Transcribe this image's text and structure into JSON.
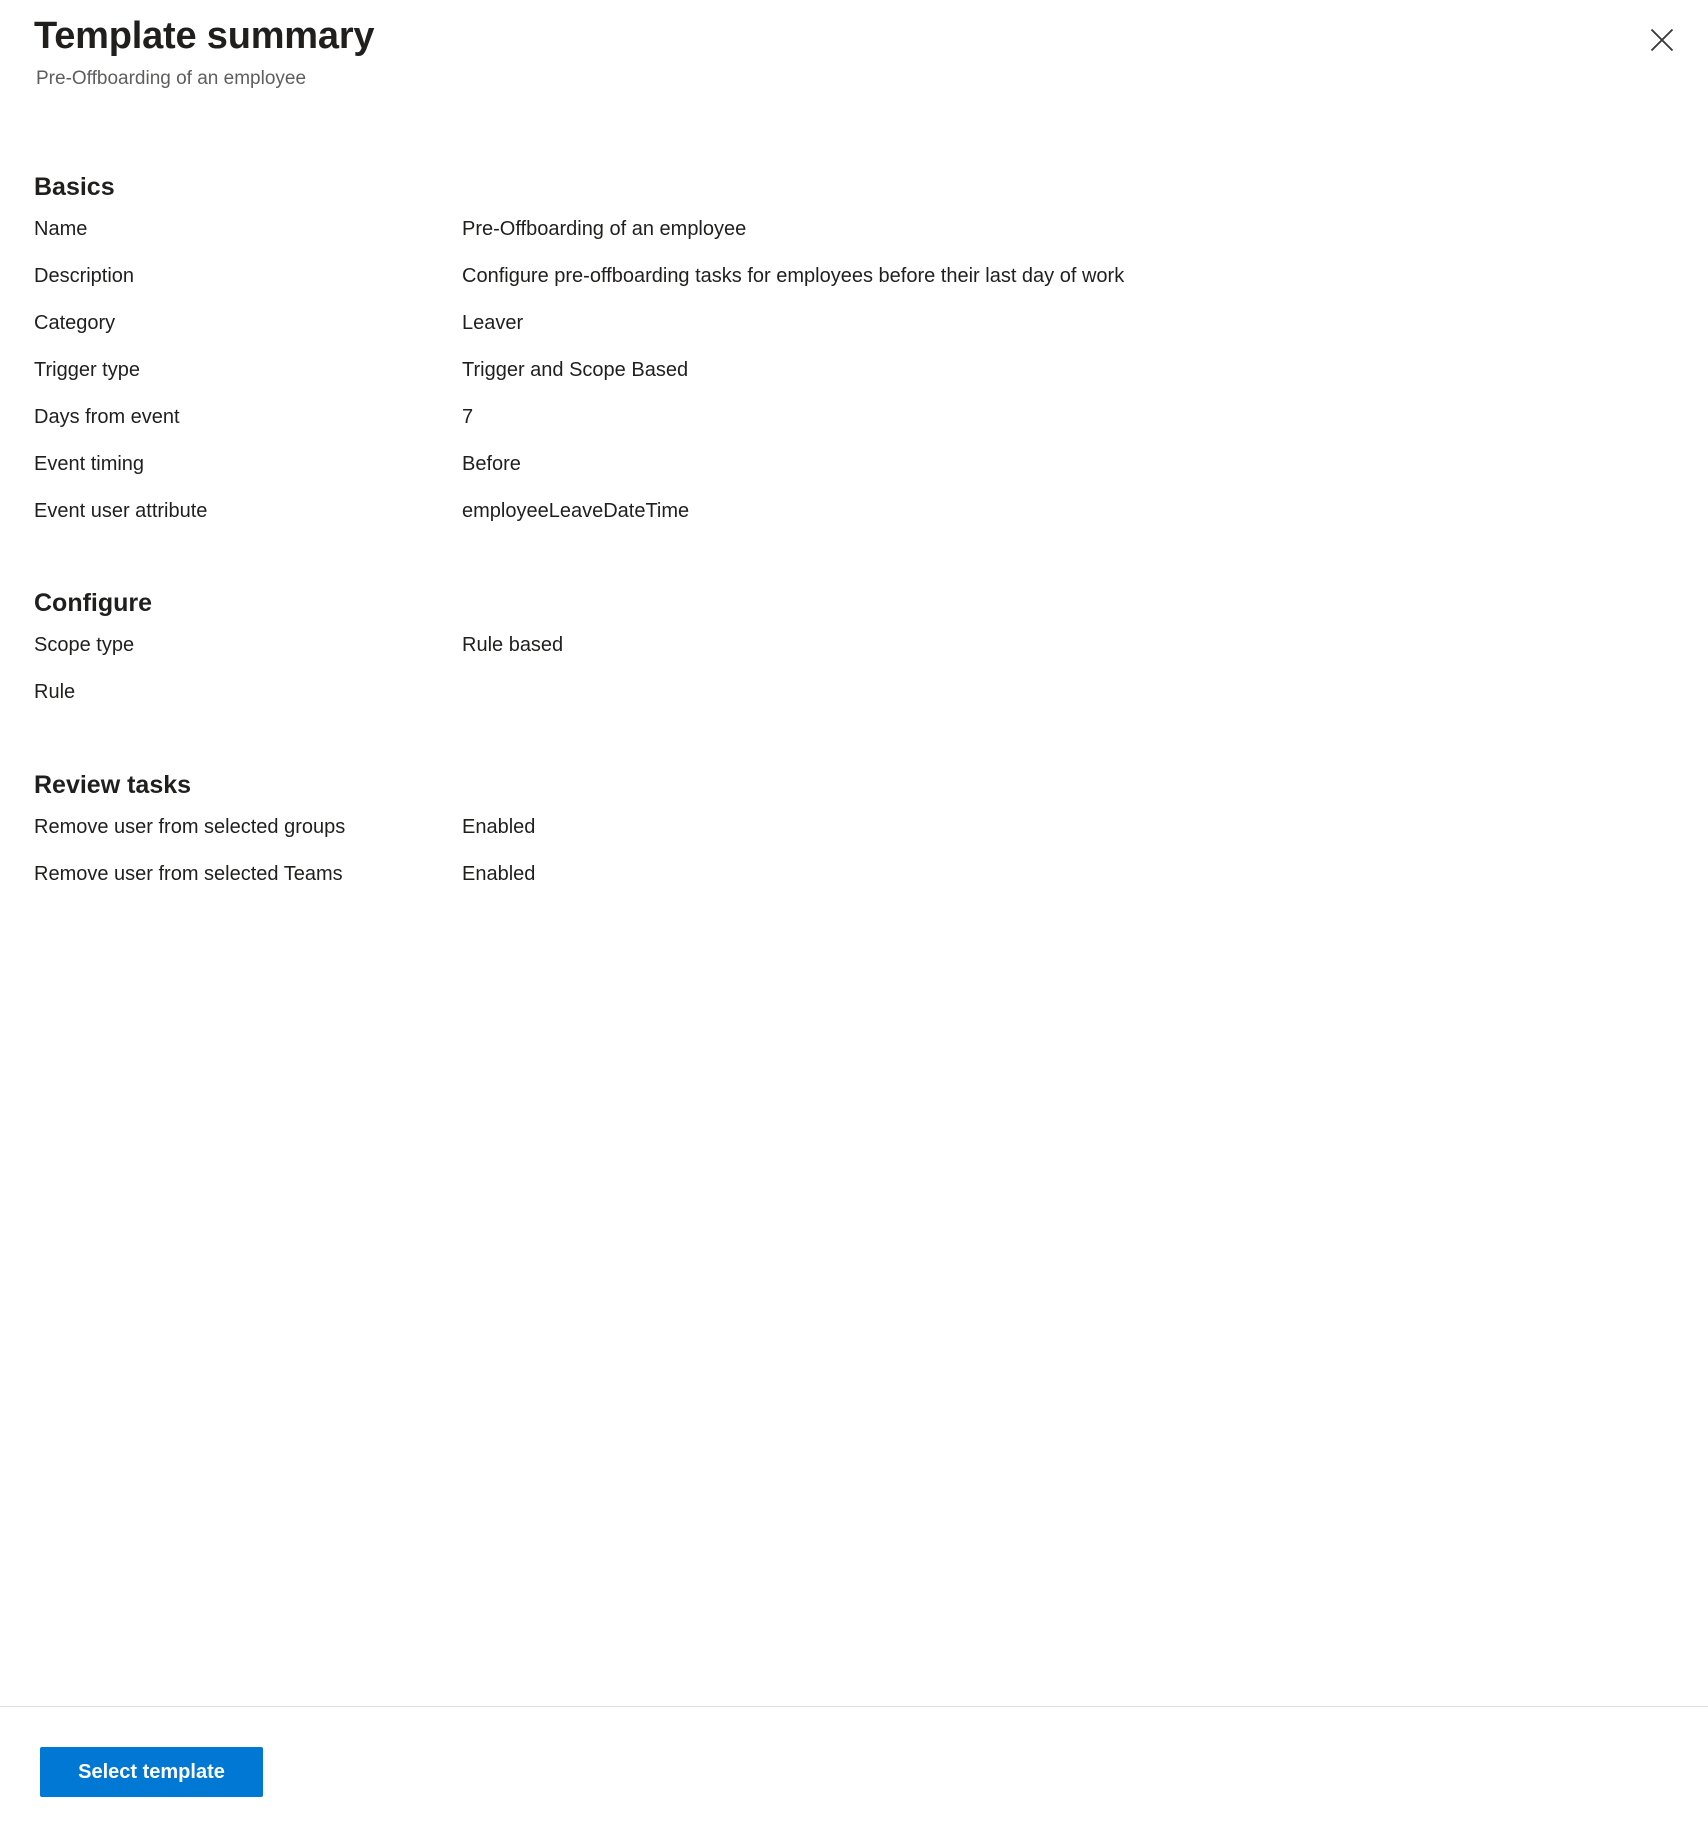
{
  "header": {
    "title": "Template summary",
    "subtitle": "Pre-Offboarding of an employee",
    "close_icon": "close-icon"
  },
  "sections": [
    {
      "id": "basics",
      "heading": "Basics",
      "rows": [
        {
          "label": "Name",
          "value": "Pre-Offboarding of an employee"
        },
        {
          "label": "Description",
          "value": "Configure pre-offboarding tasks for employees before their last day of work"
        },
        {
          "label": "Category",
          "value": "Leaver"
        },
        {
          "label": "Trigger type",
          "value": "Trigger and Scope Based"
        },
        {
          "label": "Days from event",
          "value": "7"
        },
        {
          "label": "Event timing",
          "value": "Before"
        },
        {
          "label": "Event user attribute",
          "value": "employeeLeaveDateTime"
        }
      ]
    },
    {
      "id": "configure",
      "heading": "Configure",
      "rows": [
        {
          "label": "Scope type",
          "value": "Rule based"
        },
        {
          "label": "Rule",
          "value": ""
        }
      ]
    },
    {
      "id": "review-tasks",
      "heading": "Review tasks",
      "rows": [
        {
          "label": "Remove user from selected groups",
          "value": "Enabled"
        },
        {
          "label": "Remove user from selected Teams",
          "value": "Enabled"
        }
      ]
    }
  ],
  "footer": {
    "primary_button_label": "Select template"
  },
  "colors": {
    "accent": "#0078d4",
    "text": "#201f1e",
    "muted_text": "#605e5c",
    "divider": "#e1dfdd",
    "background": "#ffffff"
  }
}
